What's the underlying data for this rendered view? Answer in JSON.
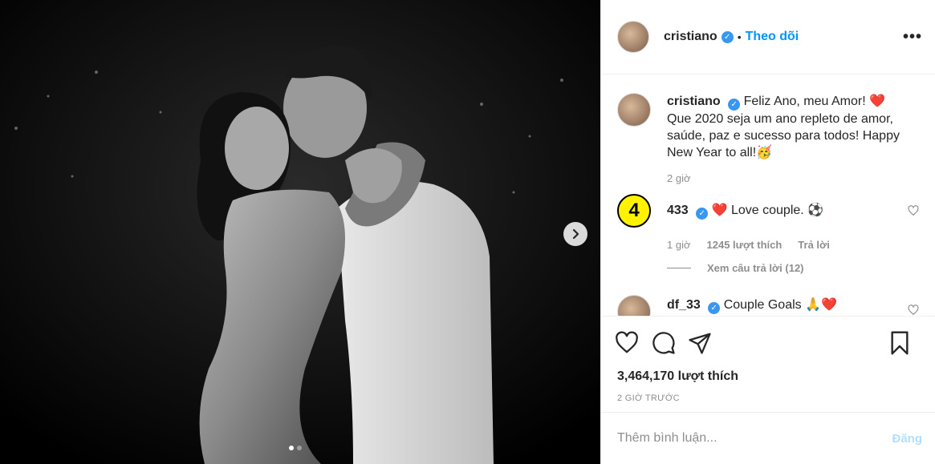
{
  "post": {
    "username": "cristiano",
    "separator": "•",
    "follow_label": "Theo dõi",
    "more_icon": "more-horizontal-icon",
    "caption": {
      "username": "cristiano",
      "text": "Feliz Ano, meu Amor! ❤️ Que 2020 seja um ano repleto de amor, saúde, paz e sucesso para todos! Happy New Year to all!🥳",
      "time": "2 giờ"
    },
    "comments": [
      {
        "username": "433",
        "avatar_text": "4",
        "text": "❤️ Love couple. ⚽",
        "time": "1 giờ",
        "likes": "1245 lượt thích",
        "reply_label": "Trả lời",
        "view_replies": "Xem câu trả lời (12)"
      },
      {
        "username": "df_33",
        "text": "Couple Goals 🙏❤️"
      }
    ],
    "like_count": "3,464,170 lượt thích",
    "timestamp": "2 GIỜ TRƯỚC",
    "comment_placeholder": "Thêm bình luận...",
    "post_label": "Đăng",
    "carousel": {
      "slides": 2,
      "active": 1
    },
    "colors": {
      "accent": "#0095f6",
      "verified": "#3897f0",
      "muted": "#8e8e8e",
      "post_disabled": "#b2dffc",
      "heart": "#ed4956"
    }
  }
}
